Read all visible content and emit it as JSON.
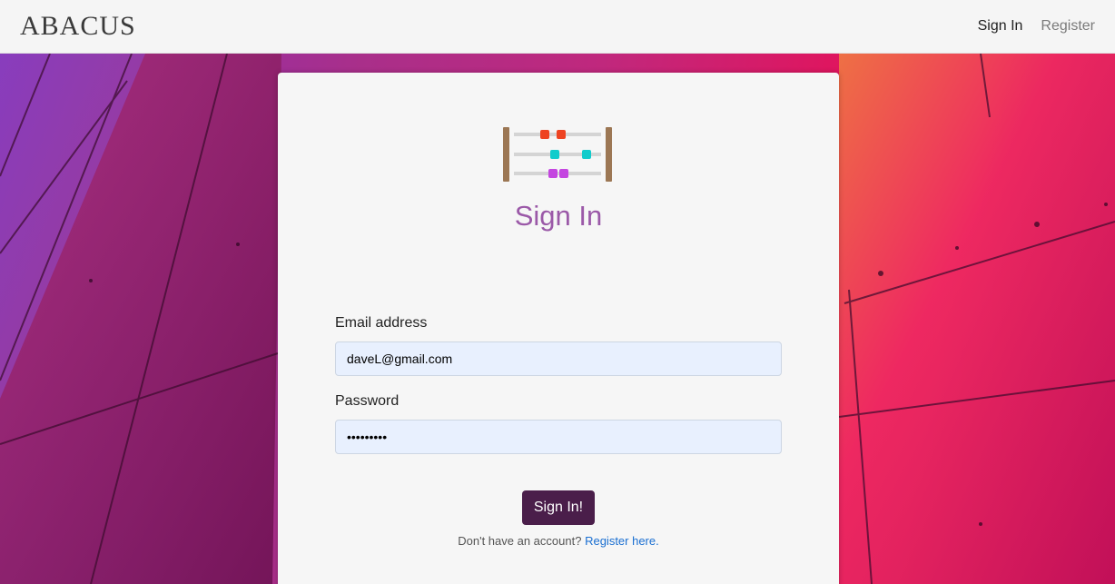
{
  "navbar": {
    "brand": "ABACUS",
    "links": [
      {
        "label": "Sign In"
      },
      {
        "label": "Register"
      }
    ]
  },
  "form": {
    "title": "Sign In",
    "email_label": "Email address",
    "email_value": "daveL@gmail.com",
    "password_label": "Password",
    "password_value": "•••••••••",
    "submit_label": "Sign In!",
    "footer_prompt": "Don't have an account?",
    "footer_link": "Register here."
  },
  "colors": {
    "title": "#9b59a8",
    "button": "#4a1e4a",
    "link": "#1a6fd1",
    "input_bg": "#e8f0fe"
  },
  "icons": {
    "logo": "abacus-icon"
  }
}
